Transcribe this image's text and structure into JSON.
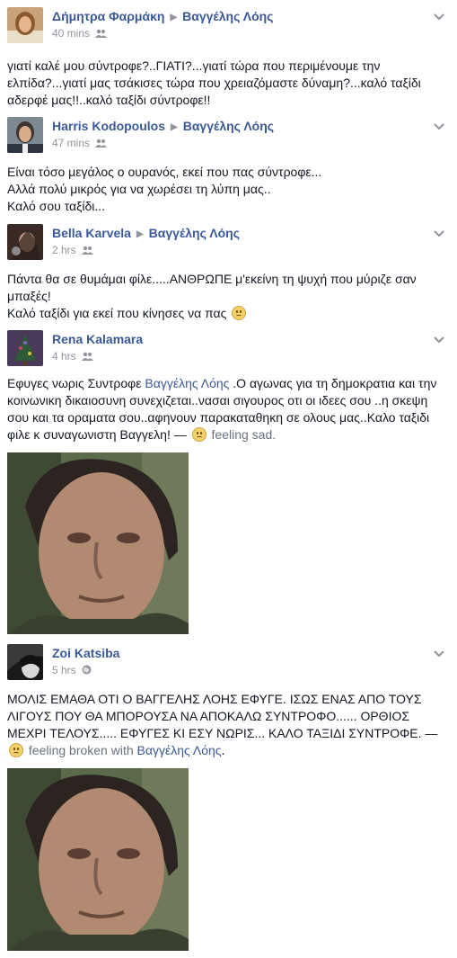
{
  "posts": [
    {
      "author": "Δήμητρα Φαρμάκη",
      "target": "Βαγγέλης Λόης",
      "time": "40 mins",
      "lines": [
        "γιατί καλέ μου σύντροφε?..ΓΙΑΤΙ?...γιατί τώρα που περιμένουμε την",
        "ελπίδα?...γιατί μας τσάκισες τώρα που χρειαζόμαστε δύναμη?...καλό ταξίδι",
        "αδερφέ μας!!..καλό ταξίδι σύντροφε!!"
      ]
    },
    {
      "author": "Harris Kodopoulos",
      "target": "Βαγγέλης Λόης",
      "time": "47 mins",
      "lines": [
        "Είναι τόσο μεγάλος ο ουρανός, εκεί που πας σύντροφε...",
        "Αλλά πολύ μικρός για να χωρέσει τη λύπη μας..",
        "Καλό σου ταξίδι..."
      ]
    },
    {
      "author": "Bella Karvela",
      "target": "Βαγγέλης Λόης",
      "time": "2 hrs",
      "lines": [
        "Πάντα θα σε θυμάμαι φίλε.....ΑΝΘΡΩΠΕ μ'εκείνη τη ψυχή που μύριζε σαν",
        "μπαξές!",
        "Καλό ταξίδι για εκεί που κίνησες να πας"
      ]
    },
    {
      "author": "Rena Kalamara",
      "time": "4 hrs",
      "line1_pre": "Εφυγες νωρις Συντροφε ",
      "line1_link": "Βαγγέλης Λόης",
      "line1_post": " .Ο αγωνας για τη δημοκρατια και την",
      "line2": "κοινωνικη δικαιοσυνη συνεχιζεται..νασαι σιγουρος οτι οι ιδεες σου ..η σκεψη",
      "line3": "σου και τα οραματα σου..αφηνουν παρακαταθηκη σε ολους μας..Καλο ταξιδι",
      "line4_pre": "φιλε κ συναγωνιστη Βαγγελη! — ",
      "feeling": "feeling sad."
    },
    {
      "author": "Zoi Katsiba",
      "time": "5 hrs",
      "line1": "ΜΟΛΙΣ ΕΜΑΘΑ ΟΤΙ Ο ΒΑΓΓΕΛΗΣ ΛΟΗΣ ΕΦΥΓΕ. ΙΣΩΣ ΕΝΑΣ ΑΠΟ ΤΟΥΣ",
      "line2": "ΛΙΓΟΥΣ ΠΟΥ ΘΑ ΜΠΟΡΟΥΣΑ ΝΑ ΑΠΟΚΑΛΩ ΣΥΝΤΡΟΦΟ...... ΟΡΘΙΟΣ",
      "line3": "ΜΕΧΡΙ ΤΕΛΟΥΣ..... ΕΦΥΓΕΣ ΚΙ ΕΣΥ ΝΩΡΙΣ... ΚΑΛΟ ΤΑΞΙΔΙ ΣΥΝΤΡΟΦΕ. —",
      "feeling": "feeling broken with",
      "with_link": "Βαγγέλης Λόης",
      "with_post": "."
    }
  ],
  "colors": {
    "link": "#3b5998",
    "meta": "#90949c",
    "text": "#141823"
  }
}
